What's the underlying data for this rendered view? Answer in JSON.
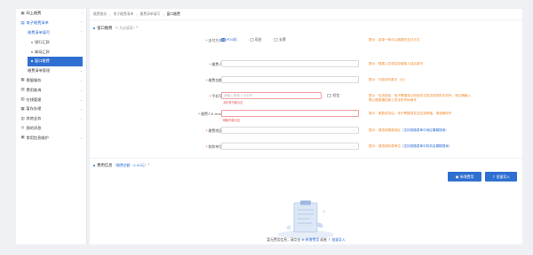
{
  "sidebar": {
    "items": [
      {
        "label": "网上缴费",
        "icon": "monitor-icon",
        "glyph": "▣"
      },
      {
        "label": "电子缴费清单",
        "icon": "list-icon",
        "glyph": "▤"
      },
      {
        "label": "缴费清单填写",
        "icon": "",
        "glyph": ""
      },
      {
        "label": "银行汇款",
        "icon": "",
        "glyph": ""
      },
      {
        "label": "邮局汇款",
        "icon": "",
        "glyph": ""
      },
      {
        "label": "窗口缴费",
        "icon": "",
        "glyph": ""
      },
      {
        "label": "缴费清单管理",
        "icon": "",
        "glyph": ""
      },
      {
        "label": "票据服务",
        "icon": "ticket-icon",
        "glyph": "▦"
      },
      {
        "label": "费用查询",
        "icon": "query-icon",
        "glyph": "▧"
      },
      {
        "label": "在线管理",
        "icon": "manage-icon",
        "glyph": "▨"
      },
      {
        "label": "暂存办理",
        "icon": "archive-icon",
        "glyph": "▩"
      },
      {
        "label": "其他业务",
        "icon": "apps-icon",
        "glyph": "▥"
      },
      {
        "label": "我的消息",
        "icon": "message-icon",
        "glyph": "◎"
      },
      {
        "label": "常用信息维护",
        "icon": "settings-icon",
        "glyph": "▣"
      }
    ]
  },
  "breadcrumb": {
    "items": [
      "缴费服务",
      "电子缴费清单",
      "缴费清单填写",
      "窗口缴费"
    ]
  },
  "form": {
    "section_title": "窗口缴费",
    "section_hint": "（* 为必填项）",
    "section_mark": "*",
    "pay_method_label": "支付方式",
    "pay_methods": [
      "POS机",
      "现金",
      "支票"
    ],
    "payer_label": "缴费人",
    "amount_label": "缴费金额",
    "phone_label": "手机号",
    "phone_placeholder": "请输入缴费人手机号",
    "phone_error": "手机号不能为空",
    "sms_label": "短信",
    "email_label": "缴费人E-mail",
    "email_error": "邮箱不能为空",
    "region_label": "缴费地区",
    "agency_label": "收款单位",
    "tips": {
      "pay_method": "提示：选择一种可以缴费的支付方式",
      "payer": "提示：根据人员或实际缴费人姓名填写",
      "amount": "提示：只能填写数字（元）",
      "phone": "提示：勾选短信，电子票据将以短信形式发送到您的手机号，请正确输入",
      "phone2": "需以缴费通知单上的手机号码填写",
      "email": "提示：缴费成功后，电子票据将发送至该邮箱，请准确填写",
      "region_prefix": "提示：请选择缴费地区",
      "region_link": "（支持按缴费单中地区模糊搜索）",
      "agency_prefix": "提示：请选择收费单位",
      "agency_link": "（支持按缴费单中机构名模糊搜索）"
    }
  },
  "fees": {
    "section_title": "费用信息",
    "summary": "（缴费总额：0.00元）",
    "section_mark": "*",
    "add_button": "新增费用",
    "import_button": "批量导入",
    "empty_prefix": "暂无费用信息，请点击",
    "empty_link1": "新增费用",
    "empty_mid": "或者",
    "empty_link2": "批量导入"
  },
  "colors": {
    "accent": "#2f6fd1",
    "tip": "#f08a2e",
    "error": "#e64a4a"
  }
}
